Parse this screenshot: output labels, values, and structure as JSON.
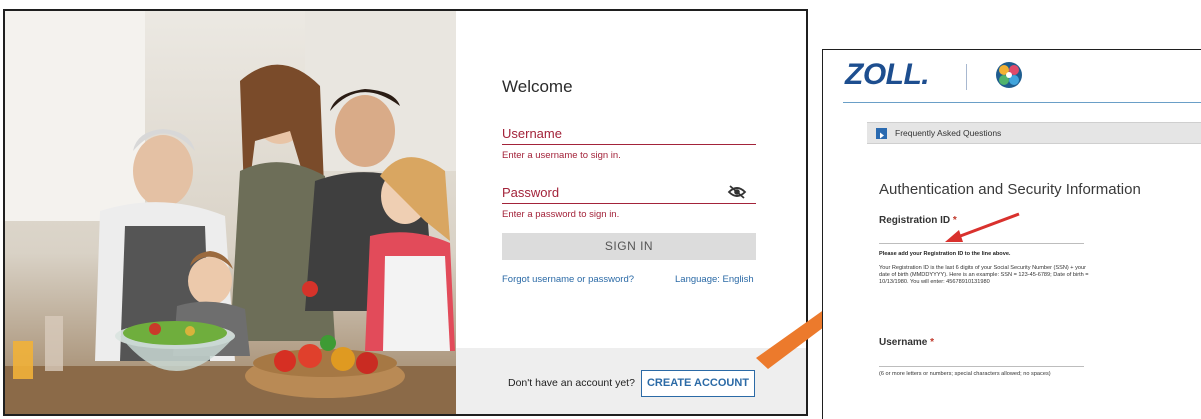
{
  "login": {
    "welcome": "Welcome",
    "username_label": "Username",
    "username_error": "Enter a username to sign in.",
    "password_label": "Password",
    "password_error": "Enter a password to sign in.",
    "sign_in_label": "SIGN IN",
    "forgot_link": "Forgot username or password?",
    "language_link": "Language: English",
    "footer_prompt": "Don't have an account yet?",
    "create_account_label": "CREATE ACCOUNT"
  },
  "registration": {
    "logo_text": "ZOLL.",
    "faq_label": "Frequently Asked Questions",
    "title": "Authentication and Security Information",
    "registration_id_label": "Registration ID",
    "required_mark": "*",
    "registration_note": "Please add your Registration ID to the line above.",
    "registration_help": "Your Registration ID is the last 6 digits of your Social Security Number (SSN) + your date of birth (MMDDYYYY). Here is an example: SSN = 123-45-6789; Date of birth = 10/13/1980. You will enter: 45678910131980",
    "username_label": "Username",
    "username_help": "(6 or more letters or numbers; special characters allowed; no spaces)"
  },
  "icons": {
    "eye": "eye-slash-icon",
    "faq": "expand-icon",
    "globe": "globe-logo-icon",
    "arrow": "orange-arrow",
    "pointer": "red-arrow"
  },
  "colors": {
    "error_red": "#a3233a",
    "link_blue": "#2b6aa6",
    "zoll_blue": "#1d4e8f",
    "arrow_orange": "#ec7a2c"
  }
}
